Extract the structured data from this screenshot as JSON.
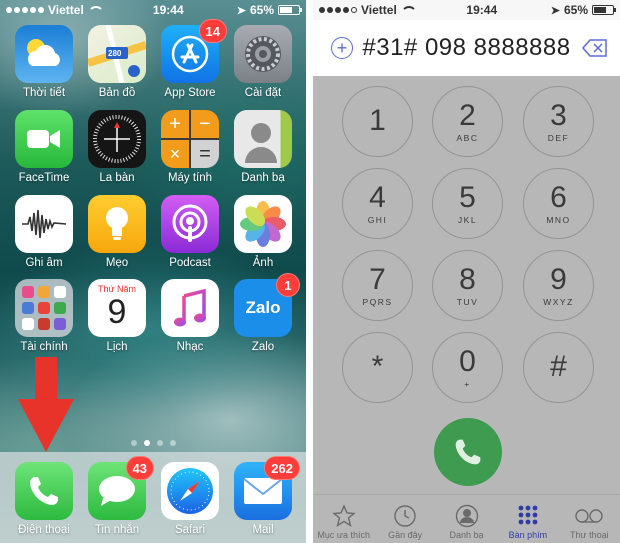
{
  "home": {
    "status": {
      "carrier": "Viettel",
      "time": "19:44",
      "battery": "65%",
      "battery_level": 0.65
    },
    "apps": [
      {
        "label": "Thời tiết",
        "icon": "weather-icon"
      },
      {
        "label": "Bản đồ",
        "icon": "maps-icon",
        "icon_text": "280"
      },
      {
        "label": "App Store",
        "icon": "appstore-icon",
        "badge": "14"
      },
      {
        "label": "Cài đặt",
        "icon": "settings-icon"
      },
      {
        "label": "FaceTime",
        "icon": "facetime-icon"
      },
      {
        "label": "La bàn",
        "icon": "compass-icon"
      },
      {
        "label": "Máy tính",
        "icon": "calculator-icon"
      },
      {
        "label": "Danh bạ",
        "icon": "contacts-icon"
      },
      {
        "label": "Ghi âm",
        "icon": "voice-memo-icon"
      },
      {
        "label": "Mẹo",
        "icon": "tips-icon"
      },
      {
        "label": "Podcast",
        "icon": "podcast-icon"
      },
      {
        "label": "Ảnh",
        "icon": "photos-icon"
      },
      {
        "label": "Tài chính",
        "icon": "finance-folder-icon"
      },
      {
        "label": "Lịch",
        "icon": "calendar-icon",
        "icon_day": "Thứ Năm",
        "icon_date": "9"
      },
      {
        "label": "Nhạc",
        "icon": "music-icon"
      },
      {
        "label": "Zalo",
        "icon": "zalo-icon",
        "icon_text": "Zalo",
        "badge": "1"
      }
    ],
    "dock": [
      {
        "label": "Điện thoại",
        "icon": "phone-icon"
      },
      {
        "label": "Tin nhắn",
        "icon": "messages-icon",
        "badge": "43"
      },
      {
        "label": "Safari",
        "icon": "safari-icon"
      },
      {
        "label": "Mail",
        "icon": "mail-icon",
        "badge": "262"
      }
    ],
    "page_count": 4,
    "active_page": 1,
    "annotation_arrow_color": "#e8332a"
  },
  "dialer": {
    "status": {
      "carrier": "Viettel",
      "time": "19:44",
      "battery": "65%",
      "battery_level": 0.65
    },
    "number": "#31# 098 8888888",
    "keys": [
      {
        "digit": "1",
        "letters": ""
      },
      {
        "digit": "2",
        "letters": "ABC"
      },
      {
        "digit": "3",
        "letters": "DEF"
      },
      {
        "digit": "4",
        "letters": "GHI"
      },
      {
        "digit": "5",
        "letters": "JKL"
      },
      {
        "digit": "6",
        "letters": "MNO"
      },
      {
        "digit": "7",
        "letters": "PQRS"
      },
      {
        "digit": "8",
        "letters": "TUV"
      },
      {
        "digit": "9",
        "letters": "WXYZ"
      },
      {
        "digit": "*",
        "letters": ""
      },
      {
        "digit": "0",
        "letters": "+"
      },
      {
        "digit": "#",
        "letters": ""
      }
    ],
    "tabs": [
      {
        "label": "Mục ưa thích",
        "icon": "star-icon"
      },
      {
        "label": "Gần đây",
        "icon": "clock-icon"
      },
      {
        "label": "Danh bạ",
        "icon": "contact-icon"
      },
      {
        "label": "Bàn phím",
        "icon": "keypad-icon",
        "active": true
      },
      {
        "label": "Thư thoại",
        "icon": "voicemail-icon"
      }
    ],
    "colors": {
      "accent": "#2e3da6",
      "call": "#3e9b4f"
    }
  }
}
